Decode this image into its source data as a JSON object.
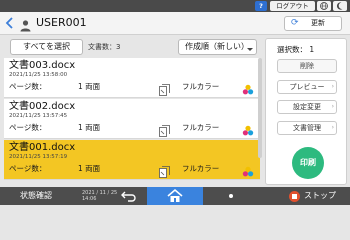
{
  "system_bar": {
    "help_label": "?",
    "logout_label": "ログアウト",
    "language_icon": "globe-icon",
    "mode_icon": "moon-icon"
  },
  "header": {
    "title": "USER001",
    "refresh_label": "更新"
  },
  "controls": {
    "select_all_label": "すべてを選択",
    "doc_count_text": "文書数：3",
    "sort_label": "作成順（新しい）"
  },
  "documents": [
    {
      "name": "文書003.docx",
      "date": "2021/11/25 13:58:00",
      "pages_label": "ページ数：",
      "pages_value": "1 両面",
      "color_mode": "フルカラー",
      "selected": false
    },
    {
      "name": "文書002.docx",
      "date": "2021/11/25 13:57:45",
      "pages_label": "ページ数：",
      "pages_value": "1 両面",
      "color_mode": "フルカラー",
      "selected": false
    },
    {
      "name": "文書001.docx",
      "date": "2021/11/25 13:57:19",
      "pages_label": "ページ数：",
      "pages_value": "1 両面",
      "color_mode": "フルカラー",
      "selected": true
    }
  ],
  "side_panel": {
    "selected_count_text": "選択数：    1",
    "delete_label": "削除",
    "preview_label": "プレビュー",
    "settings_label": "設定変更",
    "doc_mgmt_label": "文書管理",
    "print_label": "印刷"
  },
  "bottom_bar": {
    "status_label": "状態確認",
    "date": "2021 / 11 / 25",
    "time": "14:06",
    "stop_label": "ストップ"
  },
  "colors": {
    "selected_row": "#f3c623",
    "print_button": "#2dba7f",
    "home_button": "#3a83de",
    "stop_dot": "#e2512e"
  }
}
